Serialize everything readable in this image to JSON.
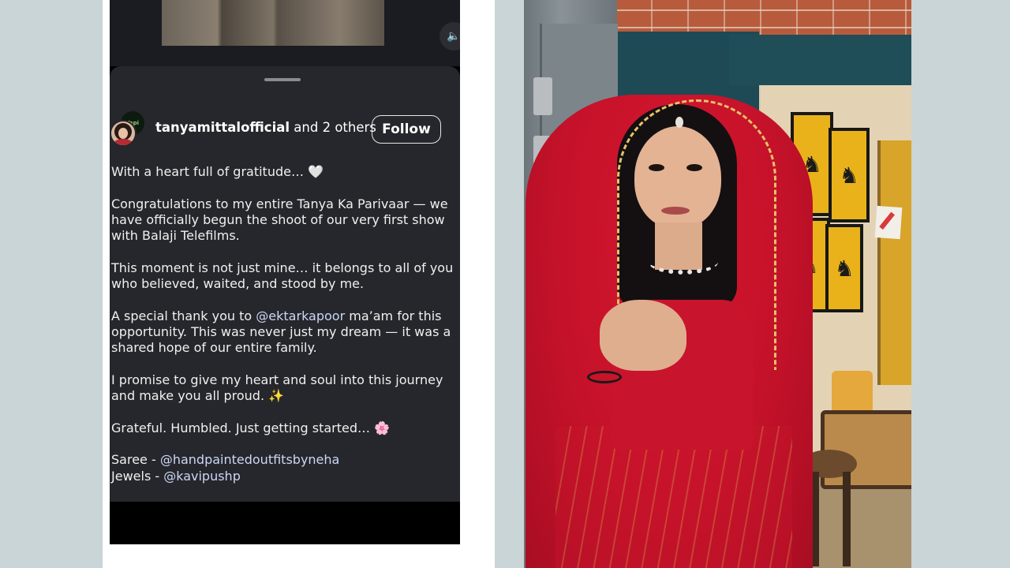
{
  "post": {
    "author": "tanyamittalofficial",
    "coauthors": "and 2 others",
    "follow_label": "Follow",
    "avatar_badge": "Tapi",
    "volume_icon": "🔈",
    "caption": [
      "With a heart full of gratitude… 🤍",
      "Congratulations to my entire Tanya Ka Parivaar — we have officially begun the shoot of our very first show with Balaji Telefilms.",
      "This moment is not just mine… it belongs to all of you who believed, waited, and stood by me.",
      "I promise to give my heart and soul into this journey and make you all proud. ✨",
      "Grateful. Humbled. Just getting started… 🌸"
    ],
    "thanks_before": "A special thank you to ",
    "thanks_mention": "@ektarkapoor",
    "thanks_after": " ma’am for this opportunity. This was never just my dream — it was a shared hope of our entire family.",
    "credits": [
      {
        "label": "Saree - ",
        "handle": "@handpaintedoutfitsbyneha"
      },
      {
        "label": "Jewels - ",
        "handle": "@kavipushp"
      }
    ]
  },
  "colors": {
    "background": "#c9d5d6",
    "sheet": "#25272c",
    "mention": "#cbd7f5",
    "dupatta_red": "#c4122a"
  },
  "icons": [
    "volume-icon",
    "white-heart-emoji",
    "sparkles-emoji",
    "cherry-blossom-emoji"
  ]
}
